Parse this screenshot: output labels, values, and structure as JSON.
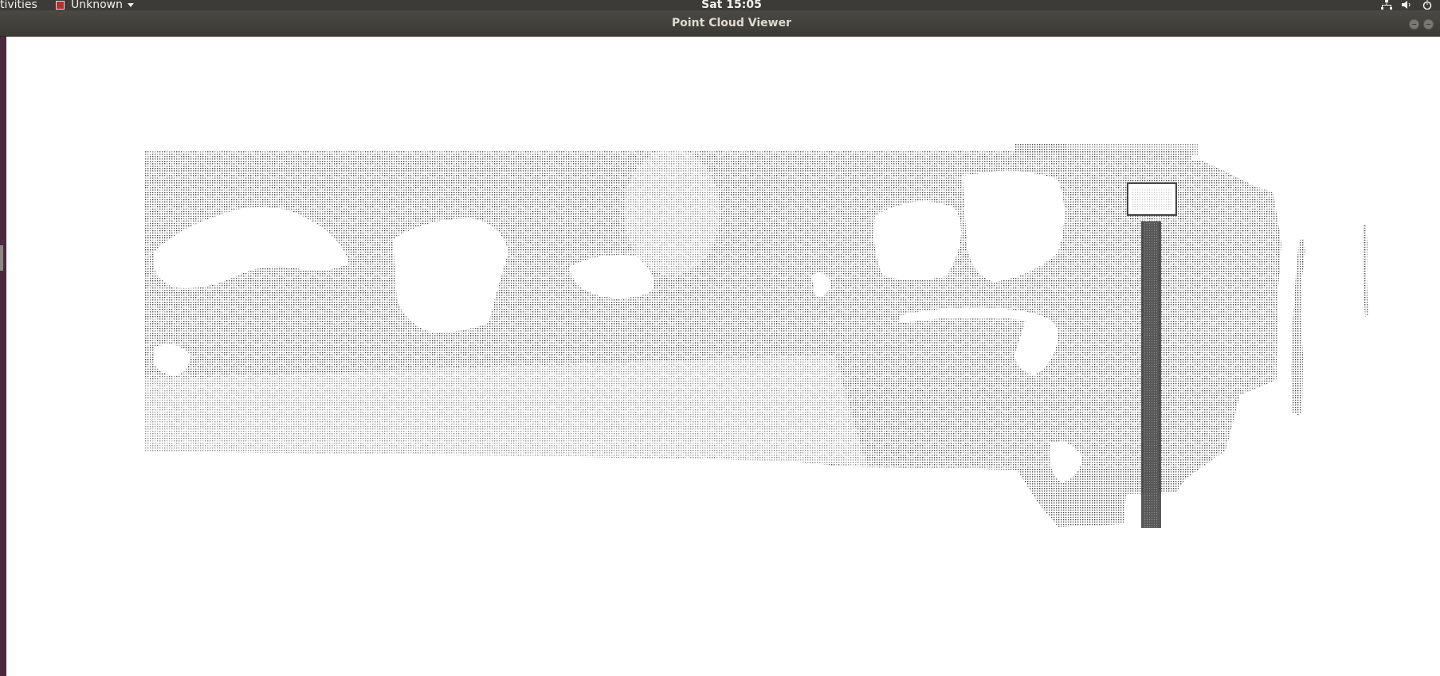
{
  "topbar": {
    "activities_label": "tivities",
    "app_menu_label": "Unknown",
    "clock": "Sat 15:05",
    "tray_icons": [
      "network-icon",
      "volume-icon",
      "power-icon"
    ]
  },
  "window": {
    "title": "Point Cloud Viewer",
    "buttons": [
      "minimize-icon",
      "maximize-icon"
    ]
  },
  "viewer": {
    "content": "point-cloud-render",
    "background_color": "#ffffff",
    "point_color": "#5a5a5a"
  }
}
